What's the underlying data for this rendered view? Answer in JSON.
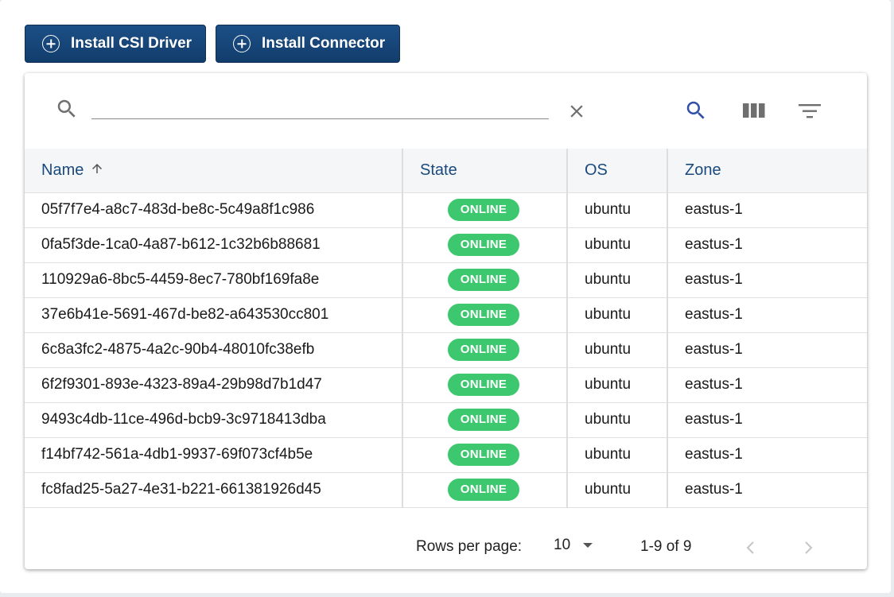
{
  "actions": {
    "install_csi_label": "Install CSI Driver",
    "install_connector_label": "Install Connector"
  },
  "search": {
    "value": "",
    "placeholder": ""
  },
  "table": {
    "headers": {
      "name": "Name",
      "state": "State",
      "os": "OS",
      "zone": "Zone"
    },
    "sort": {
      "column": "Name",
      "direction": "ascending"
    },
    "rows": [
      {
        "name": "05f7f7e4-a8c7-483d-be8c-5c49a8f1c986",
        "state": "ONLINE",
        "os": "ubuntu",
        "zone": "eastus-1"
      },
      {
        "name": "0fa5f3de-1ca0-4a87-b612-1c32b6b88681",
        "state": "ONLINE",
        "os": "ubuntu",
        "zone": "eastus-1"
      },
      {
        "name": "110929a6-8bc5-4459-8ec7-780bf169fa8e",
        "state": "ONLINE",
        "os": "ubuntu",
        "zone": "eastus-1"
      },
      {
        "name": "37e6b41e-5691-467d-be82-a643530cc801",
        "state": "ONLINE",
        "os": "ubuntu",
        "zone": "eastus-1"
      },
      {
        "name": "6c8a3fc2-4875-4a2c-90b4-48010fc38efb",
        "state": "ONLINE",
        "os": "ubuntu",
        "zone": "eastus-1"
      },
      {
        "name": "6f2f9301-893e-4323-89a4-29b98d7b1d47",
        "state": "ONLINE",
        "os": "ubuntu",
        "zone": "eastus-1"
      },
      {
        "name": "9493c4db-11ce-496d-bcb9-3c9718413dba",
        "state": "ONLINE",
        "os": "ubuntu",
        "zone": "eastus-1"
      },
      {
        "name": "f14bf742-561a-4db1-9937-69f073cf4b5e",
        "state": "ONLINE",
        "os": "ubuntu",
        "zone": "eastus-1"
      },
      {
        "name": "fc8fad25-5a27-4e31-b221-661381926d45",
        "state": "ONLINE",
        "os": "ubuntu",
        "zone": "eastus-1"
      }
    ]
  },
  "pagination": {
    "rows_per_page_label": "Rows per page:",
    "rows_per_page_value": "10",
    "range_label": "1-9 of 9"
  },
  "colors": {
    "primary_button": "#174677",
    "header_text": "#1a4a7d",
    "online_badge": "#3dc76e",
    "search_accent": "#2f4fa8"
  }
}
